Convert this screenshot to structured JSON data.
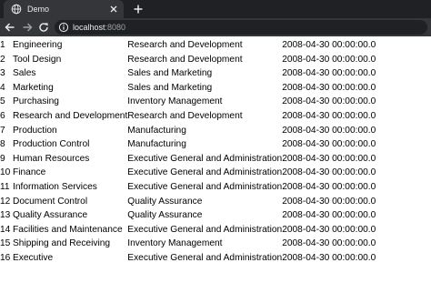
{
  "browser": {
    "tab_title": "Demo",
    "url_host": "localhost",
    "url_port": ":8080"
  },
  "rows": [
    {
      "id": "1",
      "name": "Engineering",
      "group": "Research and Development",
      "modified": "2008-04-30 00:00:00.0"
    },
    {
      "id": "2",
      "name": "Tool Design",
      "group": "Research and Development",
      "modified": "2008-04-30 00:00:00.0"
    },
    {
      "id": "3",
      "name": "Sales",
      "group": "Sales and Marketing",
      "modified": "2008-04-30 00:00:00.0"
    },
    {
      "id": "4",
      "name": "Marketing",
      "group": "Sales and Marketing",
      "modified": "2008-04-30 00:00:00.0"
    },
    {
      "id": "5",
      "name": "Purchasing",
      "group": "Inventory Management",
      "modified": "2008-04-30 00:00:00.0"
    },
    {
      "id": "6",
      "name": "Research and Development",
      "group": "Research and Development",
      "modified": "2008-04-30 00:00:00.0"
    },
    {
      "id": "7",
      "name": "Production",
      "group": "Manufacturing",
      "modified": "2008-04-30 00:00:00.0"
    },
    {
      "id": "8",
      "name": "Production Control",
      "group": "Manufacturing",
      "modified": "2008-04-30 00:00:00.0"
    },
    {
      "id": "9",
      "name": "Human Resources",
      "group": "Executive General and Administration",
      "modified": "2008-04-30 00:00:00.0"
    },
    {
      "id": "10",
      "name": "Finance",
      "group": "Executive General and Administration",
      "modified": "2008-04-30 00:00:00.0"
    },
    {
      "id": "11",
      "name": "Information Services",
      "group": "Executive General and Administration",
      "modified": "2008-04-30 00:00:00.0"
    },
    {
      "id": "12",
      "name": "Document Control",
      "group": "Quality Assurance",
      "modified": "2008-04-30 00:00:00.0"
    },
    {
      "id": "13",
      "name": "Quality Assurance",
      "group": "Quality Assurance",
      "modified": "2008-04-30 00:00:00.0"
    },
    {
      "id": "14",
      "name": "Facilities and Maintenance",
      "group": "Executive General and Administration",
      "modified": "2008-04-30 00:00:00.0"
    },
    {
      "id": "15",
      "name": "Shipping and Receiving",
      "group": "Inventory Management",
      "modified": "2008-04-30 00:00:00.0"
    },
    {
      "id": "16",
      "name": "Executive",
      "group": "Executive General and Administration",
      "modified": "2008-04-30 00:00:00.0"
    }
  ]
}
